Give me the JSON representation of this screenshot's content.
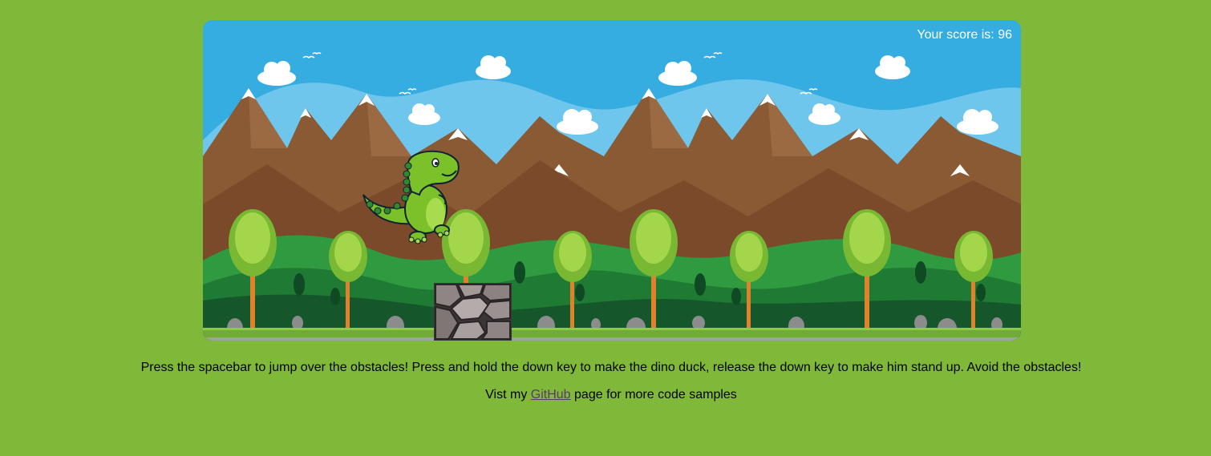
{
  "game": {
    "score_label": "Your score is:",
    "score_value": "96",
    "player": "dino",
    "obstacle": "rock",
    "colors": {
      "sky": "#35ade0",
      "page_background": "#80b839",
      "mountain": "#8a5a35",
      "grass": "#2f9a3f",
      "dino": "#7ac12a"
    }
  },
  "instructions": {
    "text": "Press the spacebar to jump over the obstacles! Press and hold the down key to make the dino duck, release the down key to make him stand up. Avoid the obstacles!"
  },
  "footer": {
    "prefix": "Vist my",
    "link_label": "GitHub",
    "suffix": "page for more code samples"
  },
  "icons": {
    "player": "dino-icon",
    "obstacle": "rock-obstacle-icon",
    "cloud": "cloud-icon",
    "bird": "bird-icon"
  }
}
